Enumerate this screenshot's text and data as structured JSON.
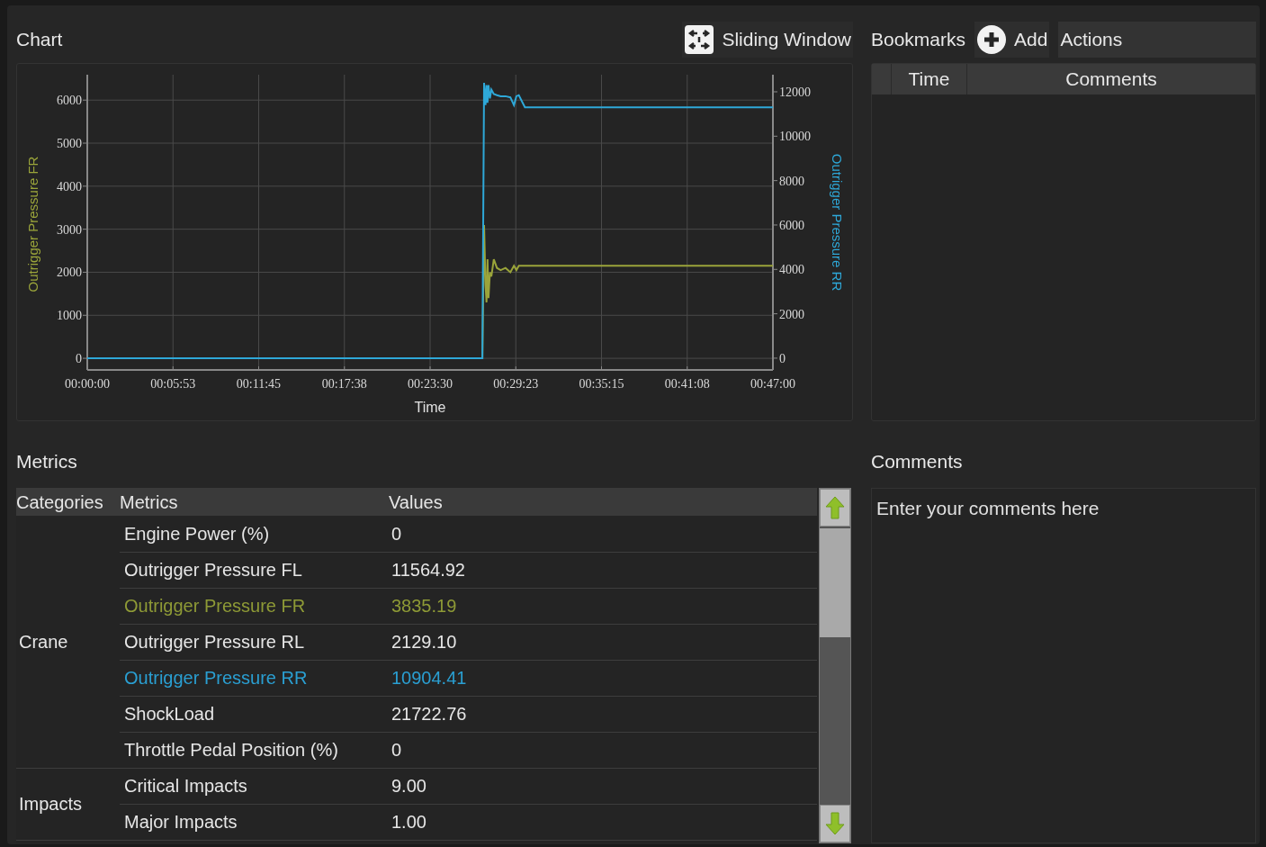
{
  "chart_panel": {
    "title": "Chart",
    "sliding_window_button": "Sliding Window",
    "chart_data": {
      "type": "line",
      "xlabel": "Time",
      "grid": true,
      "xlim": [
        0,
        2820
      ],
      "ylim": [
        -270,
        6590
      ],
      "y2lim": [
        -530,
        12770
      ],
      "xticks": [
        {
          "value": 0,
          "label": "00:00:00"
        },
        {
          "value": 352.5,
          "label": "00:05:53"
        },
        {
          "value": 705,
          "label": "00:11:45"
        },
        {
          "value": 1057.5,
          "label": "00:17:38"
        },
        {
          "value": 1410,
          "label": "00:23:30"
        },
        {
          "value": 1762.5,
          "label": "00:29:23"
        },
        {
          "value": 2115,
          "label": "00:35:15"
        },
        {
          "value": 2467.5,
          "label": "00:41:08"
        },
        {
          "value": 2820,
          "label": "00:47:00"
        }
      ],
      "yticks": [
        0,
        1000,
        2000,
        3000,
        4000,
        5000,
        6000
      ],
      "y2ticks": [
        0,
        2000,
        4000,
        6000,
        8000,
        10000,
        12000
      ],
      "x": [
        0,
        1625,
        1632,
        1638,
        1642,
        1646,
        1650,
        1656,
        1662,
        1672,
        1685,
        1700,
        1720,
        1740,
        1755,
        1765,
        1775,
        1800,
        2000,
        2820
      ],
      "series": [
        {
          "name": "Outrigger Pressure FR",
          "color": "#9aa43a",
          "values": [
            0,
            0,
            3100,
            1700,
            1300,
            2300,
            1400,
            2000,
            1900,
            2300,
            2100,
            2050,
            2100,
            2000,
            2150,
            2050,
            2150,
            2150,
            2150,
            2150
          ]
        },
        {
          "name": "Outrigger Pressure RR",
          "color": "#2ea8d8",
          "axis": "y2",
          "values": [
            0,
            0,
            12400,
            11400,
            12300,
            11500,
            12300,
            11700,
            12100,
            11900,
            11850,
            11800,
            11800,
            11750,
            11400,
            11800,
            11850,
            11300,
            11300,
            11300
          ]
        }
      ]
    }
  },
  "bookmarks_panel": {
    "title": "Bookmarks",
    "add_button": "Add",
    "actions_button": "Actions",
    "columns": [
      "Time",
      "Comments"
    ]
  },
  "metrics_panel": {
    "title": "Metrics",
    "columns": [
      "Categories",
      "Metrics",
      "Values"
    ],
    "categories": [
      {
        "name": "Crane",
        "metrics": [
          {
            "name": "Engine Power (%)",
            "value": "0",
            "color": "#e6e6e6"
          },
          {
            "name": "Outrigger Pressure FL",
            "value": "11564.92",
            "color": "#e6e6e6"
          },
          {
            "name": "Outrigger Pressure FR",
            "value": "3835.19",
            "color": "#8e9a36"
          },
          {
            "name": "Outrigger Pressure RL",
            "value": "2129.10",
            "color": "#e6e6e6"
          },
          {
            "name": "Outrigger Pressure RR",
            "value": "10904.41",
            "color": "#2a9fd2"
          },
          {
            "name": "ShockLoad",
            "value": "21722.76",
            "color": "#e6e6e6"
          },
          {
            "name": "Throttle Pedal Position (%)",
            "value": "0",
            "color": "#e6e6e6"
          }
        ]
      },
      {
        "name": "Impacts",
        "metrics": [
          {
            "name": "Critical Impacts",
            "value": "9.00",
            "color": "#e6e6e6"
          },
          {
            "name": "Major Impacts",
            "value": "1.00",
            "color": "#e6e6e6"
          }
        ]
      }
    ]
  },
  "comments_panel": {
    "title": "Comments",
    "placeholder": "Enter your comments here"
  }
}
